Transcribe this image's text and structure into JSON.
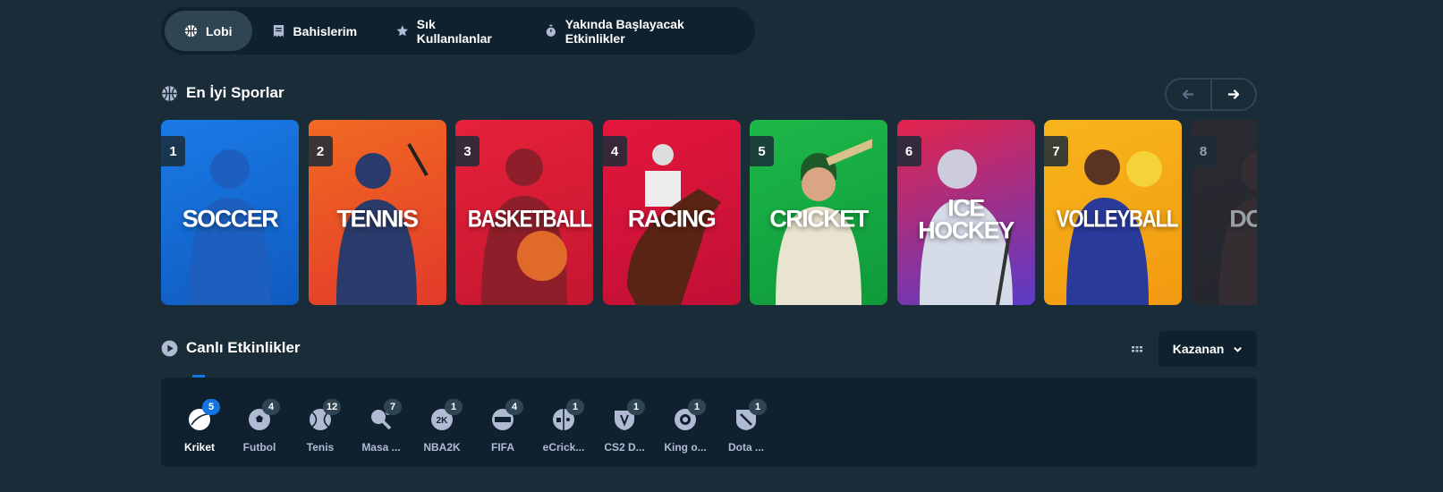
{
  "nav": {
    "items": [
      {
        "label": "Lobi",
        "icon": "basketball-icon",
        "active": true
      },
      {
        "label": "Bahislerim",
        "icon": "betslip-icon",
        "active": false
      },
      {
        "label": "Sık Kullanılanlar",
        "icon": "star-icon",
        "active": false
      },
      {
        "label": "Yakında Başlayacak Etkinlikler",
        "icon": "stopwatch-icon",
        "active": false
      }
    ]
  },
  "top_sports": {
    "title": "En İyi Sporlar",
    "cards": [
      {
        "rank": "1",
        "title": "SOCCER",
        "bg": "#1a7ae6",
        "bg2": "#0f5bc0",
        "figure": "#1c5fbf"
      },
      {
        "rank": "2",
        "title": "TENNIS",
        "bg": "#f26a22",
        "bg2": "#e23a2a",
        "figure": "#2a3a6a"
      },
      {
        "rank": "3",
        "title": "BASKETBALL",
        "bg": "#e7213a",
        "bg2": "#c41630",
        "figure": "#8e1f2a"
      },
      {
        "rank": "4",
        "title": "RACING",
        "bg": "#e4163d",
        "bg2": "#c11035",
        "figure": "#5a2414"
      },
      {
        "rank": "5",
        "title": "CRICKET",
        "bg": "#1db84a",
        "bg2": "#0e9a3a",
        "figure": "#e9e4cf"
      },
      {
        "rank": "6",
        "title": "ICE HOCKEY",
        "bg": "#e4244a",
        "bg2": "#5a3cc8",
        "figure": "#d6dbe8"
      },
      {
        "rank": "7",
        "title": "VOLLEYBALL",
        "bg": "#f7b51a",
        "bg2": "#f39a12",
        "figure": "#2a3a9a"
      },
      {
        "rank": "8",
        "title": "DOTA",
        "bg": "#3a2a2c",
        "bg2": "#2c2225",
        "figure": "#4a3030"
      }
    ]
  },
  "live": {
    "title": "Canlı Etkinlikler",
    "dropdown_label": "Kazanan",
    "tabs": [
      {
        "label": "Kriket",
        "count": "5",
        "icon": "cricket-ball-icon",
        "active": true
      },
      {
        "label": "Futbol",
        "count": "4",
        "icon": "soccer-ball-icon",
        "active": false
      },
      {
        "label": "Tenis",
        "count": "12",
        "icon": "tennis-ball-icon",
        "active": false
      },
      {
        "label": "Masa ...",
        "count": "7",
        "icon": "table-tennis-icon",
        "active": false
      },
      {
        "label": "NBA2K",
        "count": "1",
        "icon": "nba2k-icon",
        "active": false
      },
      {
        "label": "FIFA",
        "count": "4",
        "icon": "fifa-icon",
        "active": false
      },
      {
        "label": "eCrick...",
        "count": "1",
        "icon": "ecricket-icon",
        "active": false
      },
      {
        "label": "CS2 D...",
        "count": "1",
        "icon": "cs2-icon",
        "active": false
      },
      {
        "label": "King o...",
        "count": "1",
        "icon": "king-of-glory-icon",
        "active": false
      },
      {
        "label": "Dota ...",
        "count": "1",
        "icon": "dota-icon",
        "active": false
      }
    ]
  }
}
